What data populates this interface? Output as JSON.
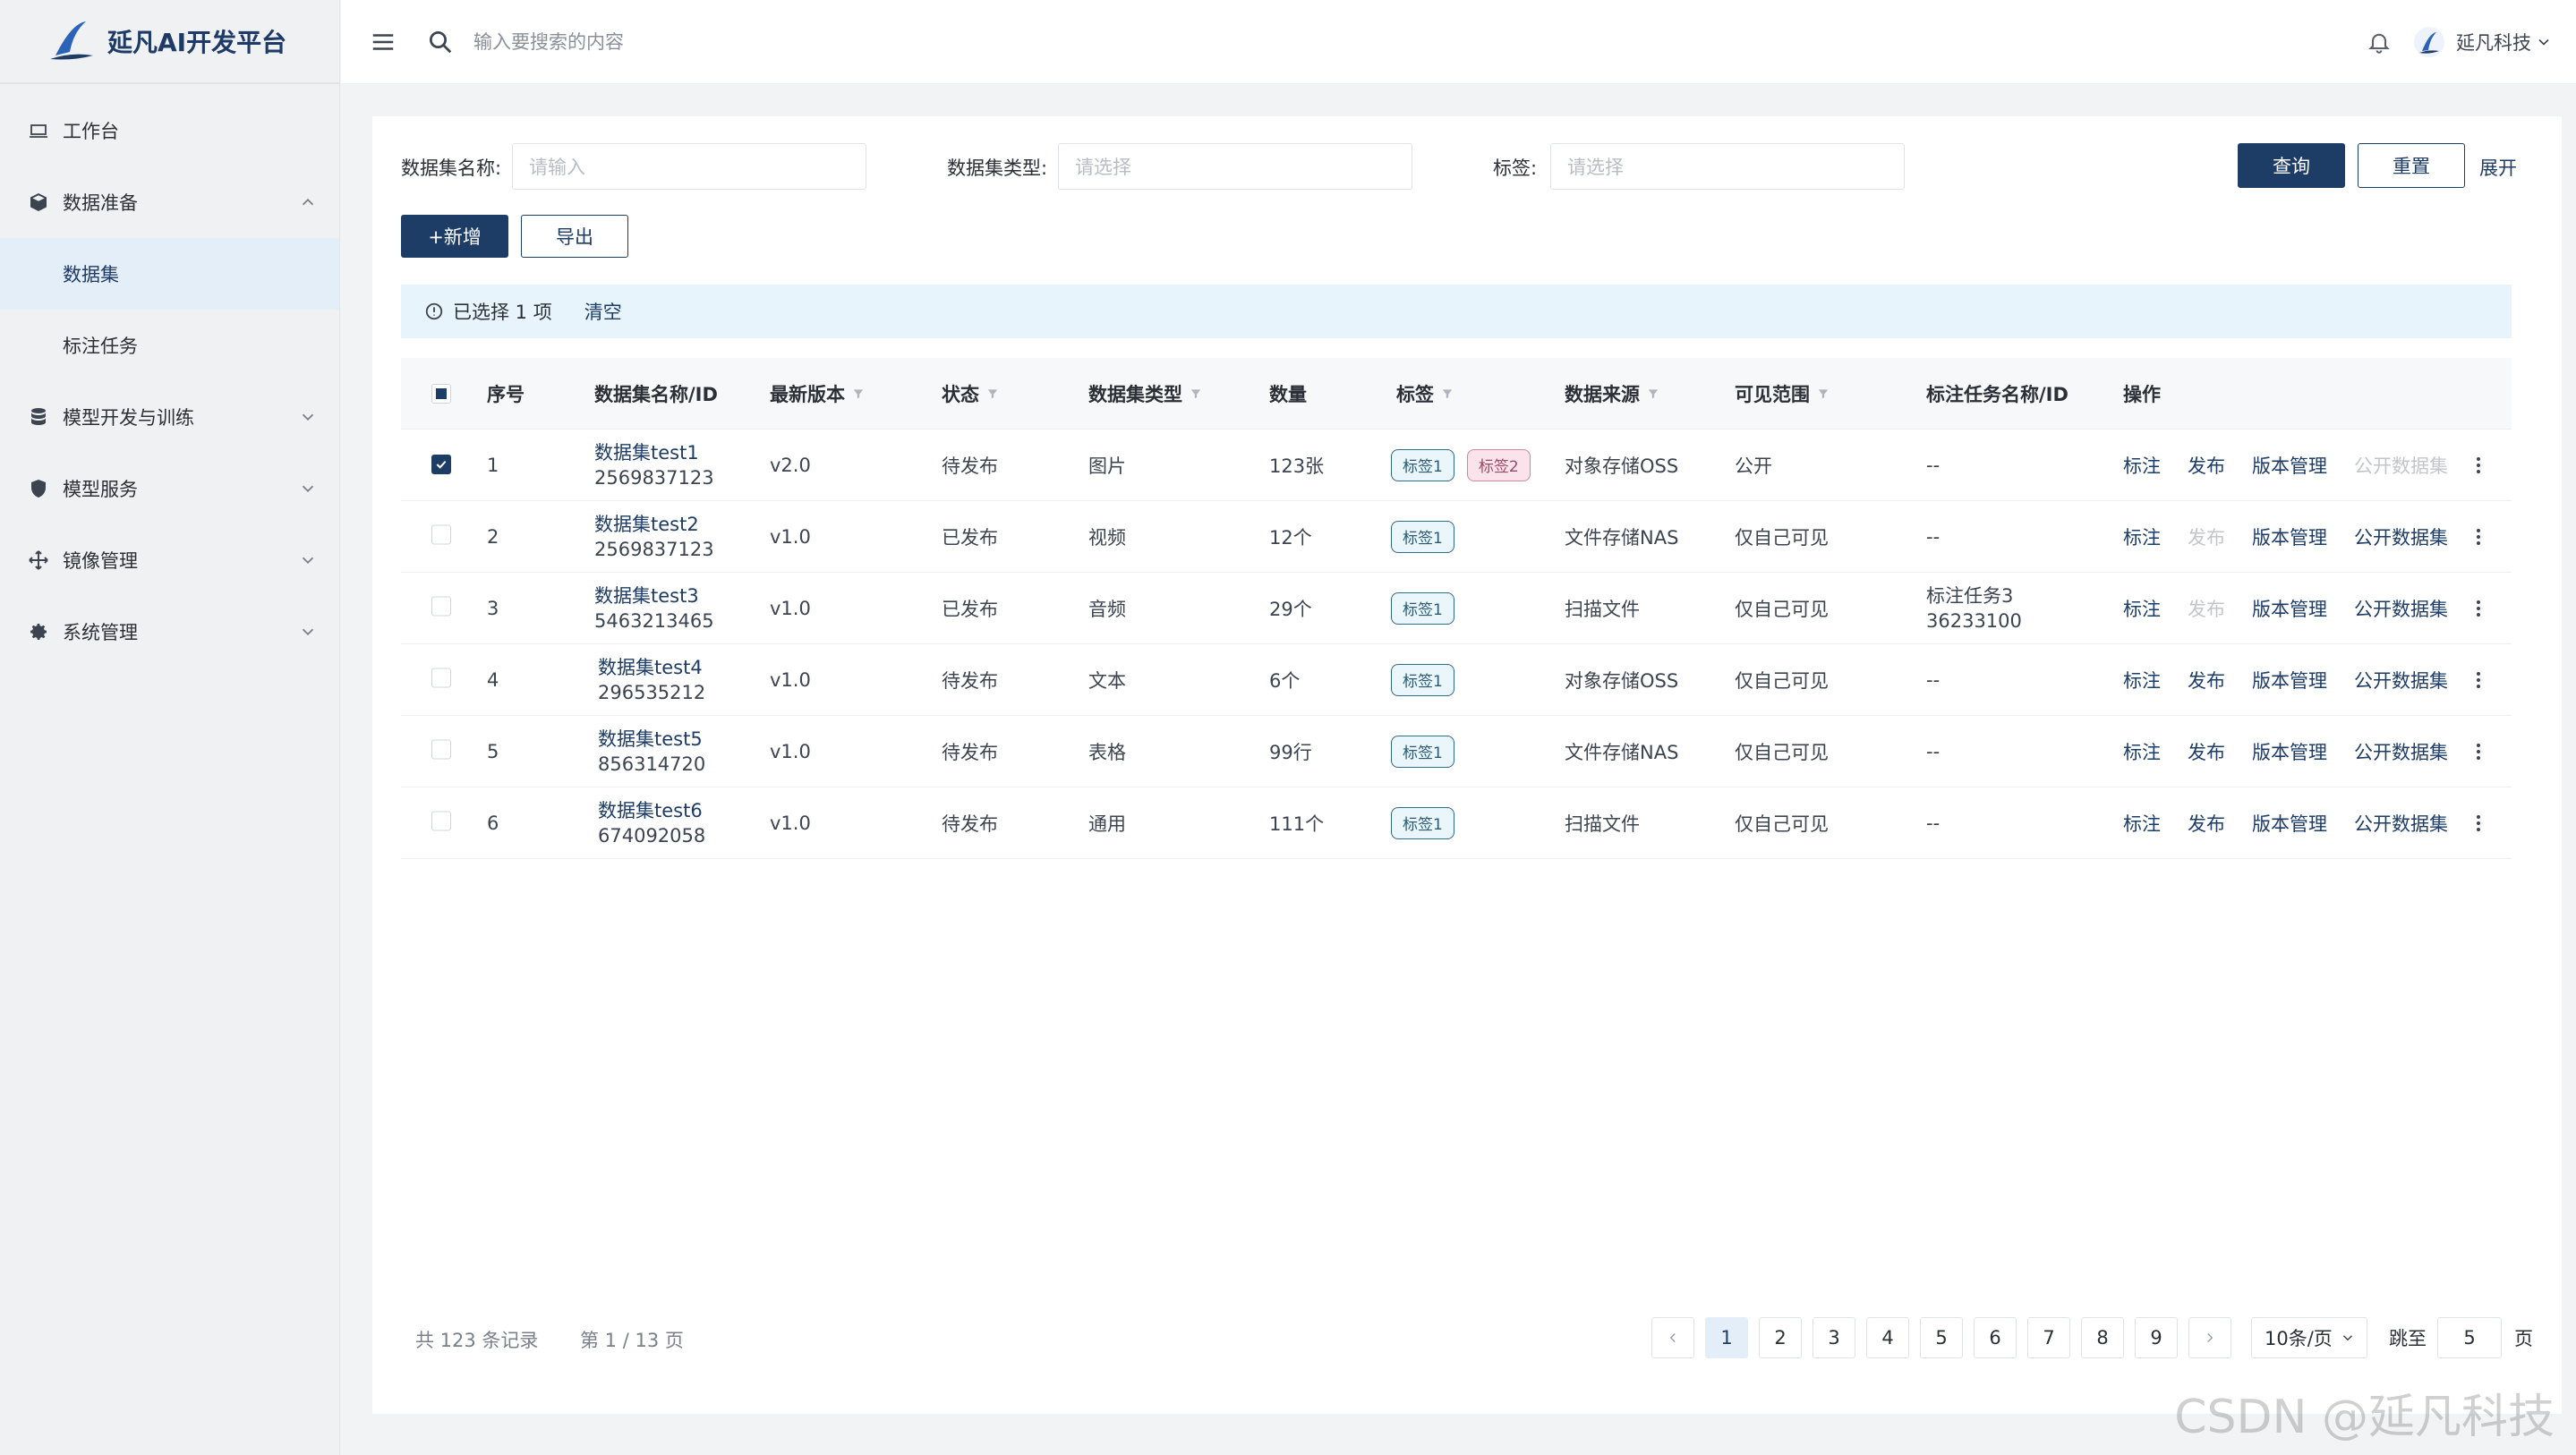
{
  "app": {
    "title": "延凡AI开发平台",
    "brand_color": "#1d3c66"
  },
  "sidebar": {
    "items": [
      {
        "label": "工作台",
        "icon": "laptop-icon"
      },
      {
        "label": "数据准备",
        "icon": "cube-icon",
        "expanded": true,
        "children": [
          {
            "label": "数据集",
            "active": true
          },
          {
            "label": "标注任务"
          }
        ]
      },
      {
        "label": "模型开发与训练",
        "icon": "database-icon"
      },
      {
        "label": "模型服务",
        "icon": "shield-icon"
      },
      {
        "label": "镜像管理",
        "icon": "move-icon"
      },
      {
        "label": "系统管理",
        "icon": "gear-icon"
      }
    ]
  },
  "header": {
    "search_placeholder": "输入要搜索的内容",
    "user_name": "延凡科技"
  },
  "filters": {
    "name_label": "数据集名称:",
    "name_placeholder": "请输入",
    "type_label": "数据集类型:",
    "type_placeholder": "请选择",
    "tag_label": "标签:",
    "tag_placeholder": "请选择",
    "query": "查询",
    "reset": "重置",
    "expand": "展开"
  },
  "toolbar": {
    "add": "+新增",
    "export": "导出"
  },
  "selection": {
    "text": "已选择 1 项",
    "clear": "清空"
  },
  "table": {
    "headers": {
      "index": "序号",
      "name": "数据集名称/ID",
      "version": "最新版本",
      "status": "状态",
      "type": "数据集类型",
      "count": "数量",
      "tags": "标签",
      "source": "数据来源",
      "visibility": "可见范围",
      "task": "标注任务名称/ID",
      "ops": "操作"
    },
    "ops_labels": {
      "annotate": "标注",
      "publish": "发布",
      "version": "版本管理",
      "public": "公开数据集"
    },
    "rows": [
      {
        "index": "1",
        "name": "数据集test1",
        "id": "2569837123",
        "version": "v2.0",
        "status": "待发布",
        "type": "图片",
        "count": "123张",
        "tag1": "标签1",
        "tag2": "标签2",
        "source": "对象存储OSS",
        "visibility": "公开",
        "task": "--",
        "checked": true
      },
      {
        "index": "2",
        "name": "数据集test2",
        "id": "2569837123",
        "version": "v1.0",
        "status": "已发布",
        "type": "视频",
        "count": "12个",
        "tag1": "标签1",
        "source": "文件存储NAS",
        "visibility": "仅自己可见",
        "task": "--"
      },
      {
        "index": "3",
        "name": "数据集test3",
        "id": "5463213465",
        "version": "v1.0",
        "status": "已发布",
        "type": "音频",
        "count": "29个",
        "tag1": "标签1",
        "source": "扫描文件",
        "visibility": "仅自己可见",
        "task_name": "标注任务3",
        "task_id": "36233100"
      },
      {
        "index": "4",
        "name": "数据集test4",
        "id": "296535212",
        "version": "v1.0",
        "status": "待发布",
        "type": "文本",
        "count": "6个",
        "tag1": "标签1",
        "source": "对象存储OSS",
        "visibility": "仅自己可见",
        "task": "--"
      },
      {
        "index": "5",
        "name": "数据集test5",
        "id": "856314720",
        "version": "v1.0",
        "status": "待发布",
        "type": "表格",
        "count": "99行",
        "tag1": "标签1",
        "source": "文件存储NAS",
        "visibility": "仅自己可见",
        "task": "--"
      },
      {
        "index": "6",
        "name": "数据集test6",
        "id": "674092058",
        "version": "v1.0",
        "status": "待发布",
        "type": "通用",
        "count": "111个",
        "tag1": "标签1",
        "source": "扫描文件",
        "visibility": "仅自己可见",
        "task": "--"
      }
    ]
  },
  "pagination": {
    "total": "共 123 条记录",
    "page_info": "第 1 / 13 页",
    "pages": [
      "1",
      "2",
      "3",
      "4",
      "5",
      "6",
      "7",
      "8",
      "9"
    ],
    "current": "1",
    "page_size": "10条/页",
    "jump_label": "跳至",
    "jump_value": "5",
    "unit": "页"
  },
  "watermark": "CSDN @延凡科技"
}
